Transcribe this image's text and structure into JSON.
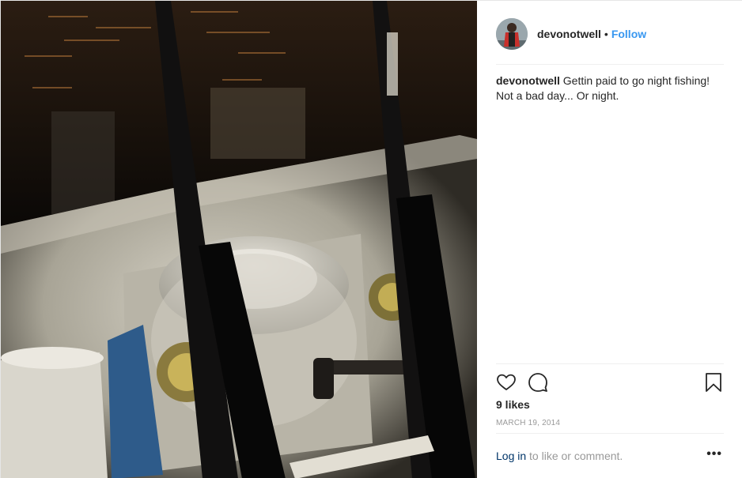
{
  "post": {
    "username": "devonotwell",
    "separator": "•",
    "follow_label": "Follow",
    "caption_user": "devonotwell",
    "caption_text": "Gettin paid to go night fishing! Not a bad day... Or night.",
    "likes": "9 likes",
    "date": "March 19, 2014",
    "login_link": "Log in",
    "login_rest": "to like or comment.",
    "more_label": "•••"
  },
  "icons": {
    "like": "heart-icon",
    "comment": "comment-bubble-icon",
    "save": "bookmark-icon",
    "more": "more-options-icon"
  },
  "colors": {
    "link": "#3897f0",
    "text": "#262626",
    "muted": "#999999",
    "login": "#003569"
  }
}
